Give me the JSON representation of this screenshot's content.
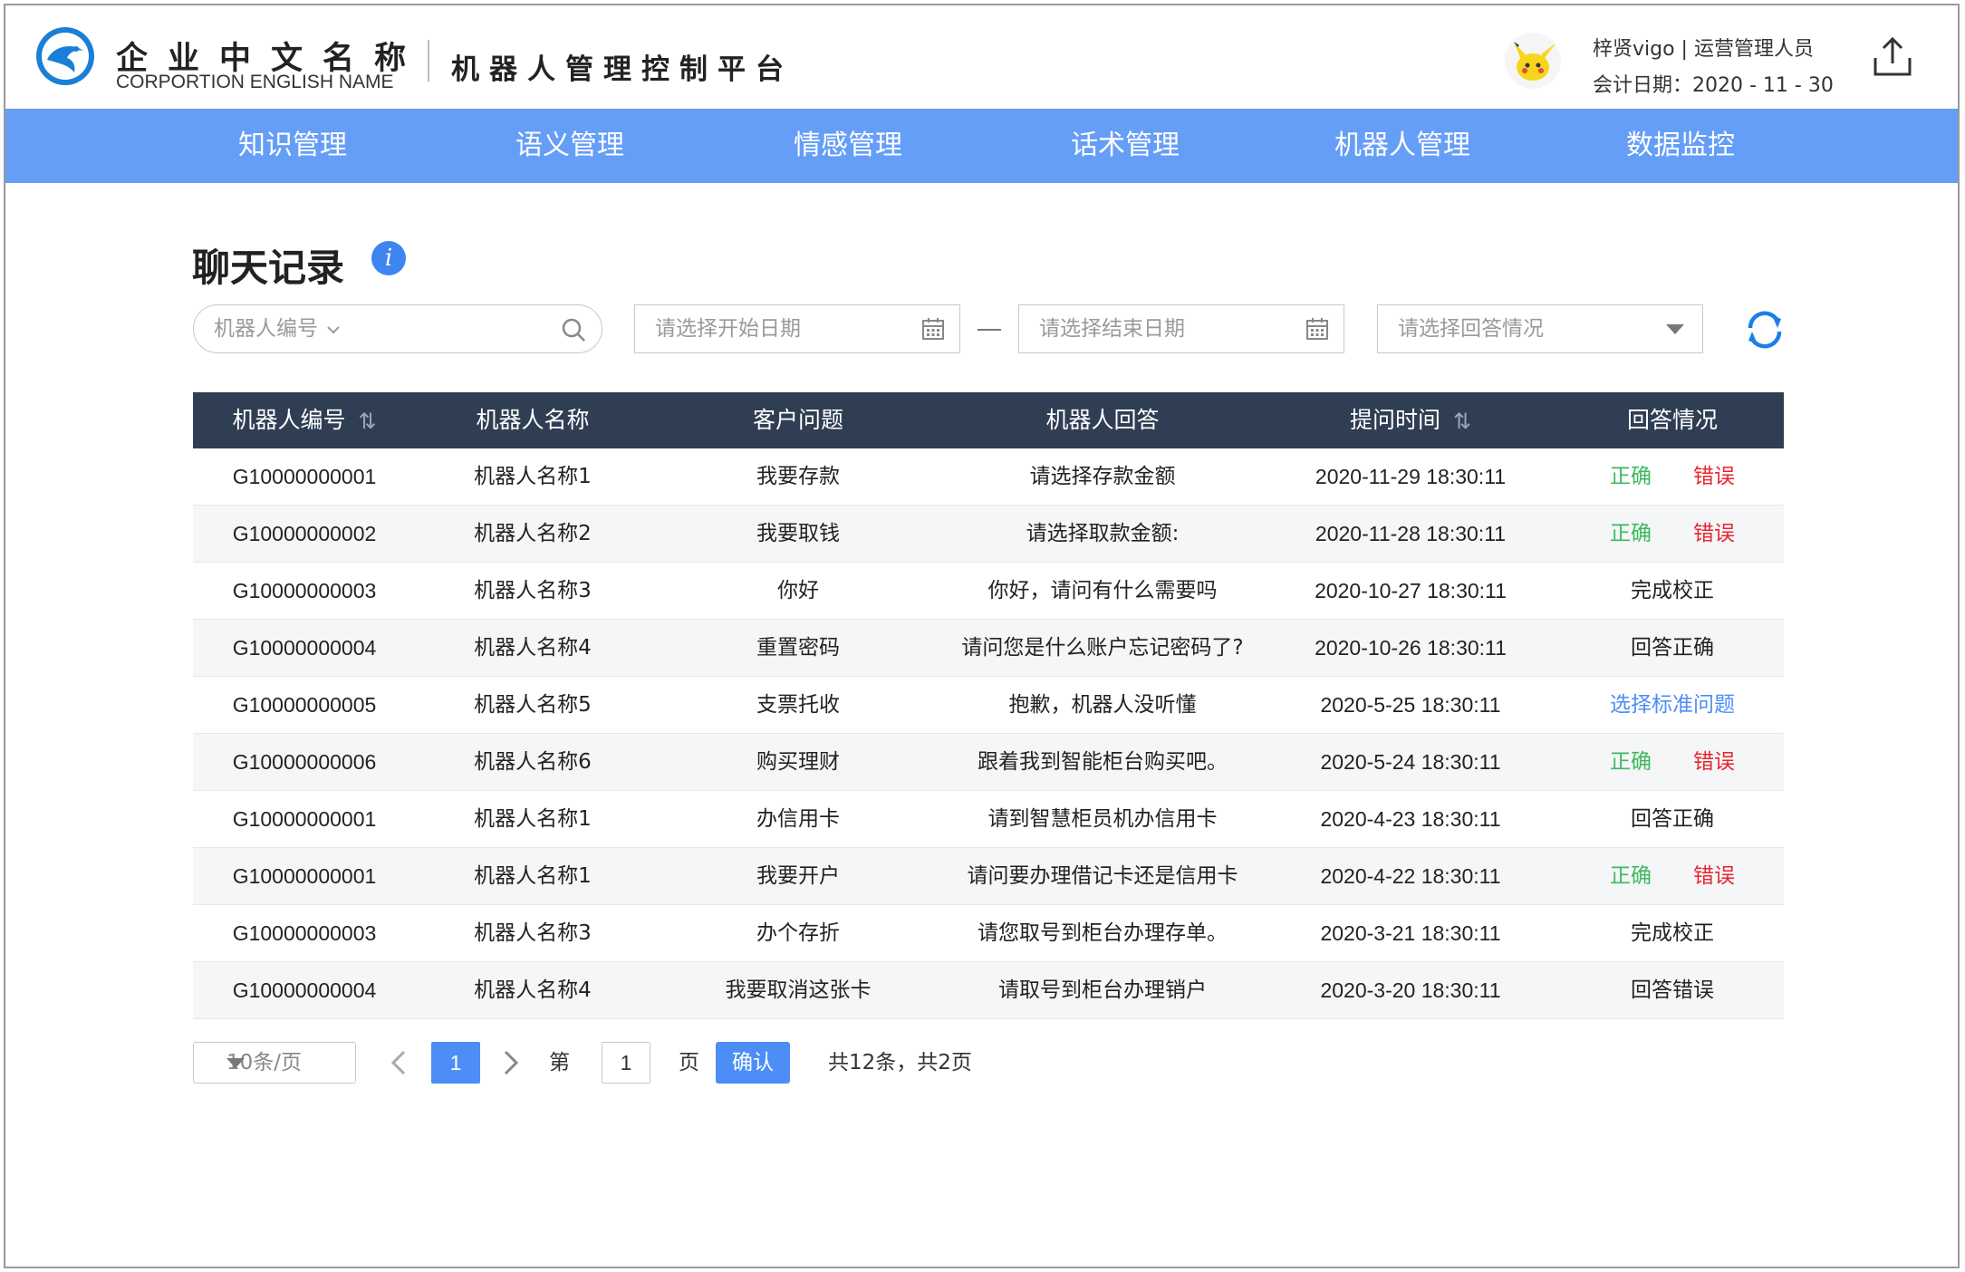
{
  "header": {
    "company_cn": "企业中文名称",
    "company_en": "CORPORTION ENGLISH NAME",
    "platform": "机器人管理控制平台",
    "user": "梓贤vigo | 运营管理人员",
    "date": "会计日期：2020 - 11 - 30"
  },
  "nav": {
    "items": [
      "知识管理",
      "语义管理",
      "情感管理",
      "话术管理",
      "机器人管理",
      "数据监控"
    ]
  },
  "page": {
    "title": "聊天记录",
    "info_glyph": "i"
  },
  "filters": {
    "robot_placeholder": "机器人编号",
    "start_placeholder": "请选择开始日期",
    "end_placeholder": "请选择结束日期",
    "answer_placeholder": "请选择回答情况"
  },
  "table": {
    "headers": [
      "机器人编号",
      "机器人名称",
      "客户问题",
      "机器人回答",
      "提问时间",
      "回答情况"
    ],
    "sort_glyph": "⇅",
    "rows": [
      {
        "id": "G10000000001",
        "name": "机器人名称1",
        "question": "我要存款",
        "answer": "请选择存款金额",
        "time": "2020-11-29 18:30:11",
        "status_type": "pair",
        "ok": "正确",
        "err": "错误"
      },
      {
        "id": "G10000000002",
        "name": "机器人名称2",
        "question": "我要取钱",
        "answer": "请选择取款金额:",
        "time": "2020-11-28 18:30:11",
        "status_type": "pair",
        "ok": "正确",
        "err": "错误"
      },
      {
        "id": "G10000000003",
        "name": "机器人名称3",
        "question": "你好",
        "answer": "你好，请问有什么需要吗",
        "time": "2020-10-27 18:30:11",
        "status_type": "text",
        "status": "完成校正"
      },
      {
        "id": "G10000000004",
        "name": "机器人名称4",
        "question": "重置密码",
        "answer": "请问您是什么账户忘记密码了?",
        "time": "2020-10-26 18:30:11",
        "status_type": "text",
        "status": "回答正确"
      },
      {
        "id": "G10000000005",
        "name": "机器人名称5",
        "question": "支票托收",
        "answer": "抱歉，机器人没听懂",
        "time": "2020-5-25 18:30:11",
        "status_type": "link",
        "status": "选择标准问题"
      },
      {
        "id": "G10000000006",
        "name": "机器人名称6",
        "question": "购买理财",
        "answer": "跟着我到智能柜台购买吧。",
        "time": "2020-5-24 18:30:11",
        "status_type": "pair",
        "ok": "正确",
        "err": "错误"
      },
      {
        "id": "G10000000001",
        "name": "机器人名称1",
        "question": "办信用卡",
        "answer": "请到智慧柜员机办信用卡",
        "time": "2020-4-23 18:30:11",
        "status_type": "text",
        "status": "回答正确"
      },
      {
        "id": "G10000000001",
        "name": "机器人名称1",
        "question": "我要开户",
        "answer": "请问要办理借记卡还是信用卡",
        "time": "2020-4-22 18:30:11",
        "status_type": "pair",
        "ok": "正确",
        "err": "错误"
      },
      {
        "id": "G10000000003",
        "name": "机器人名称3",
        "question": "办个存折",
        "answer": "请您取号到柜台办理存单。",
        "time": "2020-3-21 18:30:11",
        "status_type": "text",
        "status": "完成校正"
      },
      {
        "id": "G10000000004",
        "name": "机器人名称4",
        "question": "我要取消这张卡",
        "answer": "请取号到柜台办理销户",
        "time": "2020-3-20 18:30:11",
        "status_type": "text",
        "status": "回答错误"
      }
    ]
  },
  "pagination": {
    "page_size": "10条/页",
    "current": "1",
    "di": "第",
    "page_input": "1",
    "ye": "页",
    "confirm": "确认",
    "summary": "共12条，共2页"
  }
}
